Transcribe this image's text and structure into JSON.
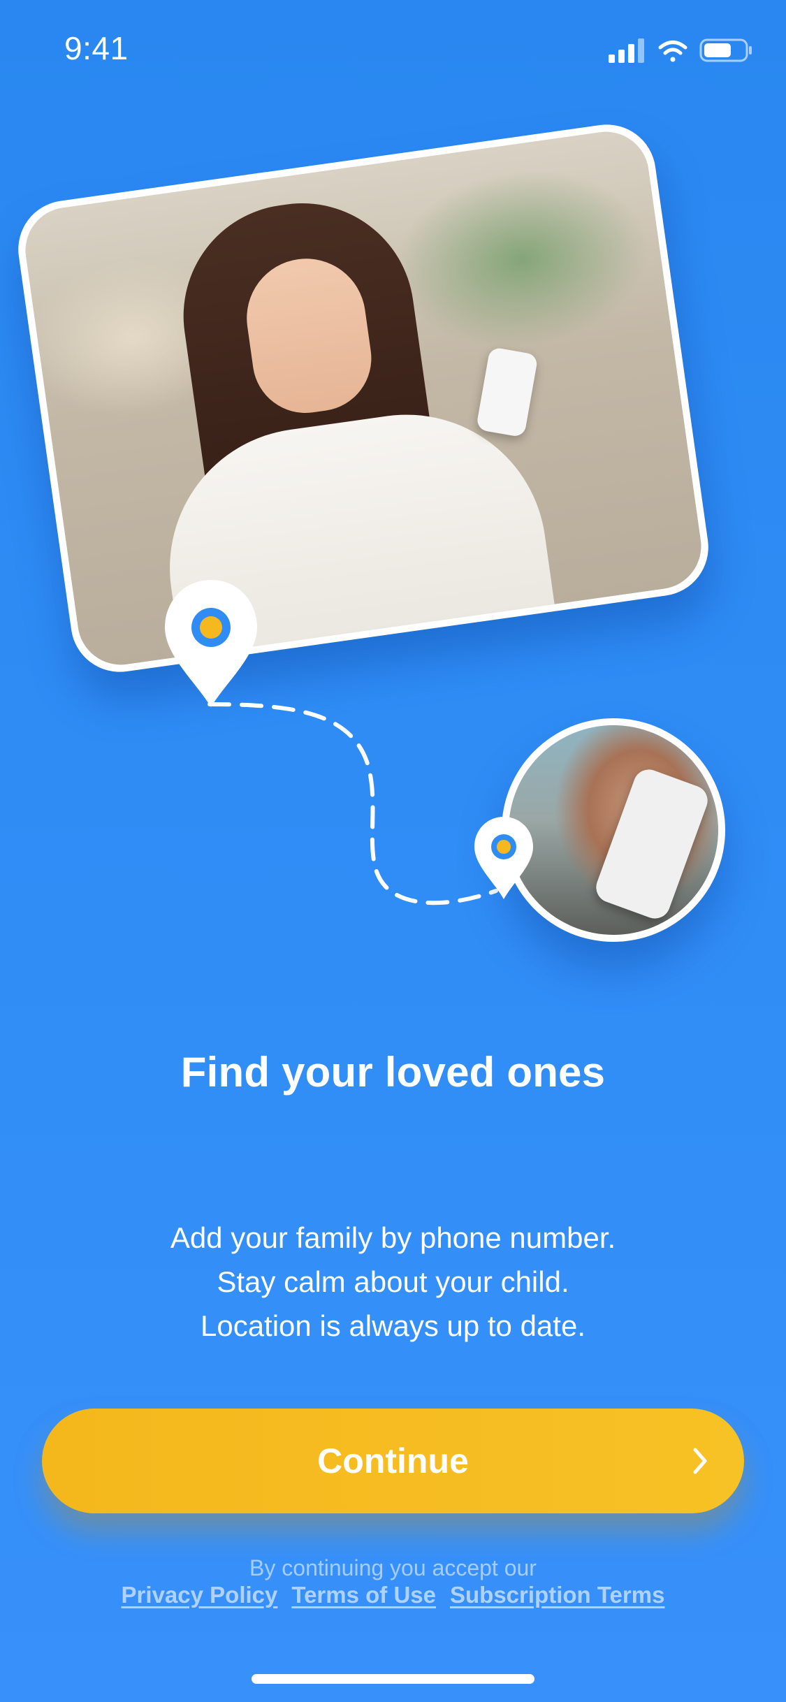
{
  "status_bar": {
    "time": "9:41",
    "icons": [
      "cellular-signal-icon",
      "wifi-icon",
      "battery-icon"
    ]
  },
  "hero": {
    "photo_subject": "woman-with-phone-photo",
    "avatar_subject": "man-with-phone-photo",
    "pin_color_inner": "#f5b91f",
    "pin_color_ring": "#2f8cf5"
  },
  "content": {
    "title": "Find your loved ones",
    "subtitle_lines": [
      "Add your family by phone number.",
      "Stay calm about your child.",
      "Location is always up to date."
    ]
  },
  "continue_button": {
    "label": "Continue",
    "icon": "chevron-right-icon",
    "color": "#f5b91f"
  },
  "legal": {
    "caption": "By continuing you accept our",
    "links": [
      "Privacy Policy",
      "Terms of Use",
      "Subscription Terms"
    ]
  },
  "colors": {
    "background": "#2f8cf5",
    "accent": "#f5b91f",
    "text": "#ffffff"
  }
}
